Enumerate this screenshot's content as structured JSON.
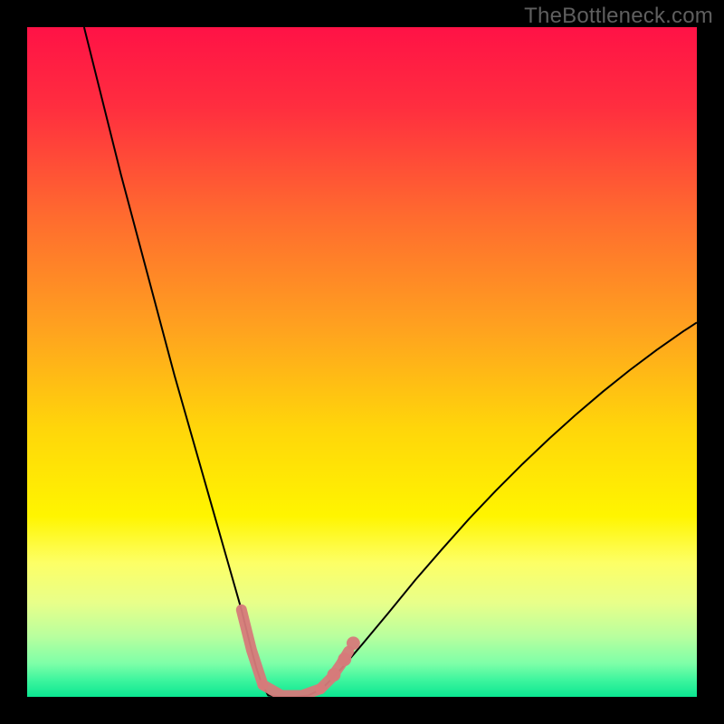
{
  "watermark": "TheBottleneck.com",
  "chart_data": {
    "type": "line",
    "title": "",
    "xlabel": "",
    "ylabel": "",
    "xlim": [
      0,
      100
    ],
    "ylim": [
      0,
      100
    ],
    "grid": false,
    "legend": false,
    "background_gradient": {
      "stops": [
        {
          "offset": 0.0,
          "color": "#ff1246"
        },
        {
          "offset": 0.12,
          "color": "#ff2e3f"
        },
        {
          "offset": 0.28,
          "color": "#ff6a2f"
        },
        {
          "offset": 0.45,
          "color": "#ffa21f"
        },
        {
          "offset": 0.6,
          "color": "#ffd60a"
        },
        {
          "offset": 0.73,
          "color": "#fff500"
        },
        {
          "offset": 0.8,
          "color": "#fdff66"
        },
        {
          "offset": 0.86,
          "color": "#e8ff8a"
        },
        {
          "offset": 0.91,
          "color": "#b8ff9e"
        },
        {
          "offset": 0.95,
          "color": "#7effa8"
        },
        {
          "offset": 0.975,
          "color": "#3df59e"
        },
        {
          "offset": 1.0,
          "color": "#0be691"
        }
      ]
    },
    "series": [
      {
        "name": "bottleneck-curve",
        "color": "#000000",
        "stroke_width": 2,
        "x": [
          8.5,
          10,
          12,
          14,
          16,
          18,
          20,
          22,
          24,
          26,
          27,
          28,
          29,
          30,
          31,
          32,
          32.8,
          33.5,
          34.2,
          35,
          36,
          38,
          40,
          42,
          44,
          45,
          47,
          50,
          54,
          58,
          62,
          66,
          70,
          74,
          78,
          82,
          86,
          90,
          94,
          98,
          100
        ],
        "y": [
          100,
          94,
          86,
          78,
          70.5,
          63,
          55.5,
          48,
          41,
          34,
          30.5,
          27,
          23.5,
          20,
          16.5,
          13,
          9.8,
          7,
          4.4,
          2,
          0.2,
          0,
          0,
          0.2,
          1.2,
          2.2,
          4.3,
          7.8,
          12.6,
          17.5,
          22.1,
          26.6,
          30.8,
          34.8,
          38.6,
          42.2,
          45.6,
          48.8,
          51.8,
          54.6,
          55.9
        ]
      }
    ],
    "overlay_marks": {
      "name": "highlight-segment",
      "color": "#d67a7a",
      "stroke_width": 12,
      "segments": [
        {
          "x": [
            32.0,
            33.5,
            35.2
          ],
          "y": [
            13.0,
            7.0,
            1.8
          ]
        },
        {
          "x": [
            35.2,
            38.0,
            41.0,
            43.8
          ],
          "y": [
            1.8,
            0.2,
            0.2,
            1.2
          ]
        },
        {
          "x": [
            43.8,
            45.4,
            46.8,
            48.0
          ],
          "y": [
            1.2,
            2.8,
            4.8,
            6.8
          ]
        }
      ],
      "dots": [
        {
          "x": 45.8,
          "y": 3.3
        },
        {
          "x": 47.4,
          "y": 5.6
        },
        {
          "x": 48.7,
          "y": 8.0
        }
      ]
    }
  }
}
